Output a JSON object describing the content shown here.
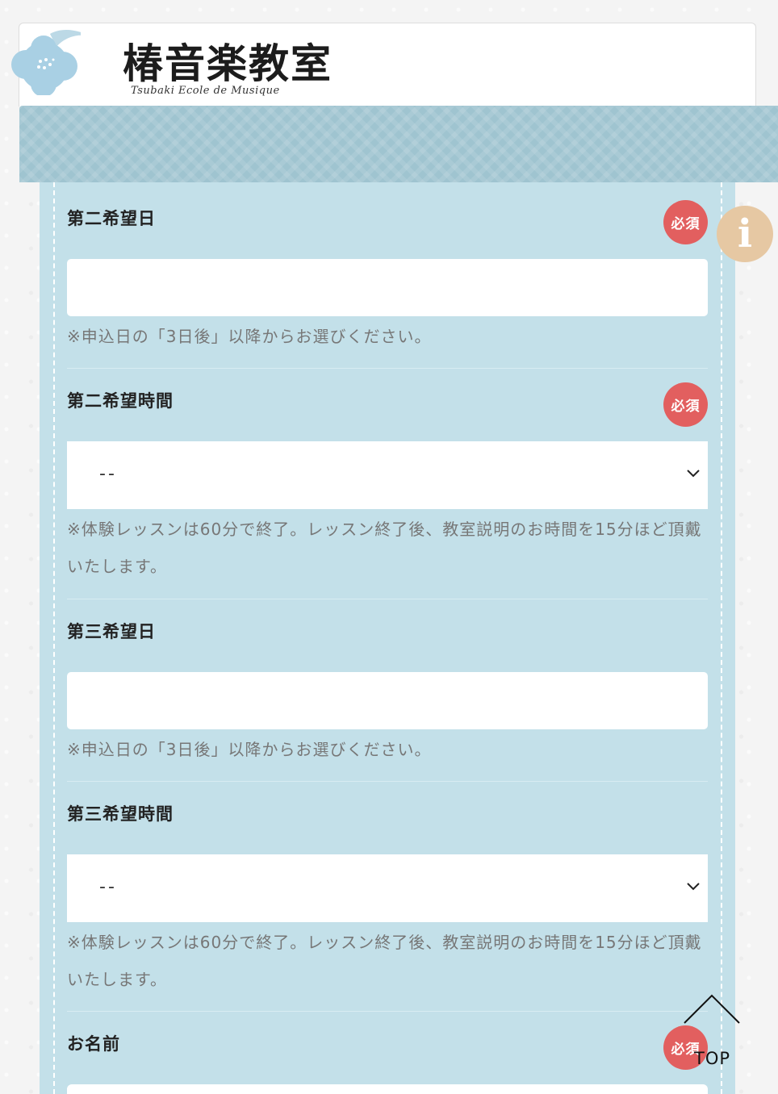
{
  "header": {
    "logo_title": "椿音楽教室",
    "logo_subtitle": "Tsubaki Ecole de Musique"
  },
  "form": {
    "required_label": "必須",
    "fields": [
      {
        "label": "第二希望日",
        "required": true,
        "type": "text",
        "value": "",
        "note": "※申込日の「3日後」以降からお選びください。"
      },
      {
        "label": "第二希望時間",
        "required": true,
        "type": "select",
        "value": "--",
        "note": "※体験レッスンは60分で終了。レッスン終了後、教室説明のお時間を15分ほど頂戴いたします。"
      },
      {
        "label": "第三希望日",
        "required": false,
        "type": "text",
        "value": "",
        "note": "※申込日の「3日後」以降からお選びください。"
      },
      {
        "label": "第三希望時間",
        "required": false,
        "type": "select",
        "value": "--",
        "note": "※体験レッスンは60分で終了。レッスン終了後、教室説明のお時間を15分ほど頂戴いたします。"
      },
      {
        "label": "お名前",
        "required": true,
        "type": "text",
        "value": ""
      }
    ]
  },
  "floating": {
    "info_glyph": "i",
    "top_label": "TOP"
  },
  "colors": {
    "panel_bg": "#c3e0e9",
    "banner_bg": "#9fc4d0",
    "required_badge": "#e25f5f",
    "info_button": "#e6c8a3"
  }
}
